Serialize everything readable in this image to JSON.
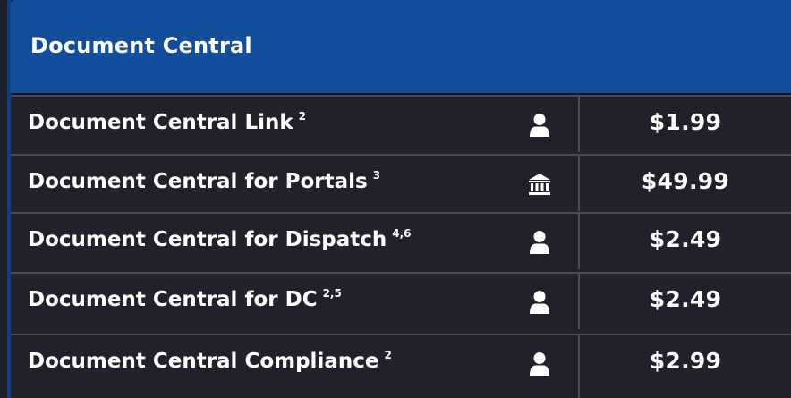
{
  "header": {
    "title": "Document Central"
  },
  "rows": [
    {
      "label": "Document Central Link",
      "footnote": "2",
      "icon": "user-icon",
      "price": "$1.99"
    },
    {
      "label": "Document Central for Portals",
      "footnote": "3",
      "icon": "bank-icon",
      "price": "$49.99"
    },
    {
      "label": "Document Central for Dispatch",
      "footnote": "4,6",
      "icon": "user-icon",
      "price": "$2.49"
    },
    {
      "label": "Document Central for DC",
      "footnote": "2,5",
      "icon": "user-icon",
      "price": "$2.49"
    },
    {
      "label": "Document Central Compliance",
      "footnote": "2",
      "icon": "user-icon",
      "price": "$2.99"
    }
  ],
  "colors": {
    "header": "#124e9b",
    "background": "#20212a",
    "divider": "#4a4b55"
  }
}
